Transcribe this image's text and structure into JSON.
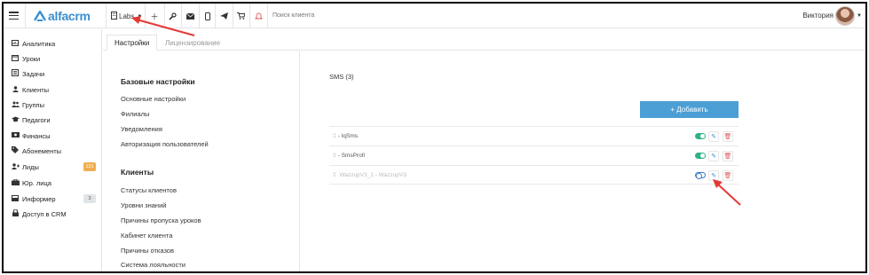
{
  "topbar": {
    "logo_text": "alfacrm",
    "branch_label": "Labs",
    "search_placeholder": "Поиск клиента",
    "user_name": "Виктория",
    "icons": [
      "plus-icon",
      "wrench-icon",
      "envelope-icon",
      "phone-icon",
      "telegram-icon",
      "cart-icon",
      "bell-icon"
    ]
  },
  "sidebar": {
    "items": [
      {
        "label": "Аналитика",
        "icon": "chart-icon"
      },
      {
        "label": "Уроки",
        "icon": "calendar-icon"
      },
      {
        "label": "Задачи",
        "icon": "tasks-icon"
      },
      {
        "label": "Клиенты",
        "icon": "user-icon"
      },
      {
        "label": "Группы",
        "icon": "users-icon"
      },
      {
        "label": "Педагоги",
        "icon": "graduation-cap-icon"
      },
      {
        "label": "Финансы",
        "icon": "money-icon"
      },
      {
        "label": "Абонементы",
        "icon": "tag-icon"
      },
      {
        "label": "Лиды",
        "icon": "user-plus-icon",
        "badge": "121"
      },
      {
        "label": "Юр. лица",
        "icon": "briefcase-icon"
      },
      {
        "label": "Информер",
        "icon": "inbox-icon",
        "badge": "3"
      },
      {
        "label": "Доступ в CRM",
        "icon": "lock-icon"
      }
    ]
  },
  "tabs": [
    {
      "label": "Настройки",
      "active": true
    },
    {
      "label": "Лицензирование",
      "active": false
    }
  ],
  "settings_nav": {
    "basic_heading": "Базовые настройки",
    "basic_links": [
      "Основные настройки",
      "Филиалы",
      "Уведомления",
      "Авторизация пользователей"
    ],
    "clients_heading": "Клиенты",
    "client_links": [
      "Статусы клиентов",
      "Уровни знаний",
      "Причины пропуска уроков",
      "Кабинет клиента",
      "Причины отказов",
      "Система лояльности"
    ]
  },
  "content": {
    "title": "SMS (3)",
    "add_button": "+ Добавить",
    "rows": [
      {
        "label": "- IqSms",
        "enabled": true
      },
      {
        "label": "- SmsProfi",
        "enabled": true
      },
      {
        "label": "WazzupV3_1 - WazzupV3",
        "enabled": false
      }
    ]
  },
  "colors": {
    "accent": "#4b9fd5",
    "toggle_on": "#2fb383",
    "badge_orange": "#f0ad4e",
    "annotation_arrow": "#e53935"
  }
}
